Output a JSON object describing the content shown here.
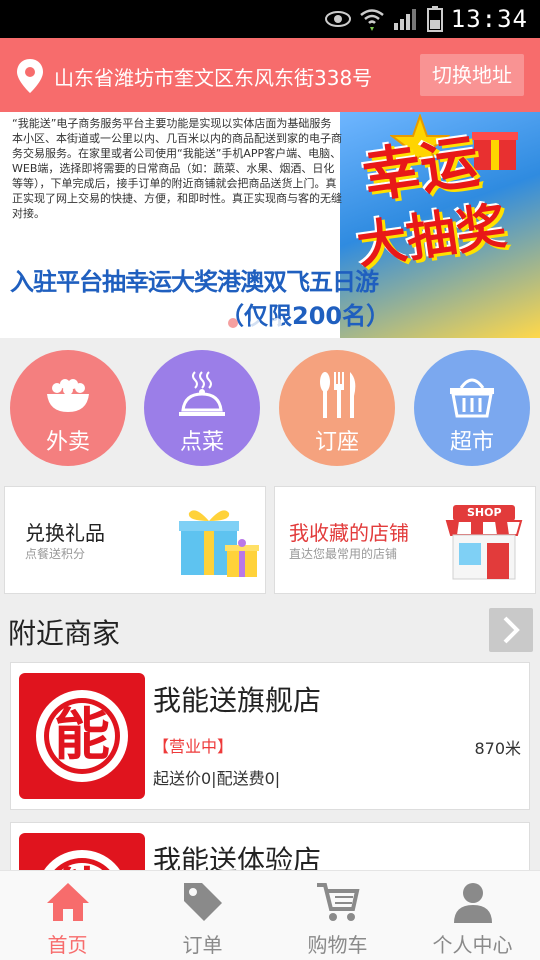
{
  "status_bar": {
    "time": "13:34"
  },
  "header": {
    "address": "山东省潍坊市奎文区东风东街338号",
    "switch_label": "切换地址",
    "accent": "#f76c6c"
  },
  "banner": {
    "intro_text": "“我能送”电子商务服务平台主要功能是实现以实体店面为基础服务本小区、本街道或一公里以内、几百米以内的商品配送到家的电子商务交易服务。在家里或者公司使用“我能送”手机APP客户端、电脑、WEB端，选择即将需要的日常商品（如：蔬菜、水果、烟酒、日化等等），下单完成后，接手订单的附近商铺就会把商品送货上门。真正实现了网上交易的快捷、方便，和即时性。真正实现商与客的无缝对接。",
    "promo_line1": "入驻平台抽幸运大奖港澳双飞五日游",
    "promo_line2": "（仅限200名）",
    "lucky_line1": "幸运",
    "lucky_line2": "大抽奖",
    "slide_count": 3,
    "active_slide": 1
  },
  "categories": [
    {
      "label": "外卖",
      "icon": "food-bowl-icon",
      "color": "#f47f7f"
    },
    {
      "label": "点菜",
      "icon": "dish-cover-icon",
      "color": "#9b7ee8"
    },
    {
      "label": "订座",
      "icon": "cutlery-icon",
      "color": "#f5a27e"
    },
    {
      "label": "超市",
      "icon": "basket-icon",
      "color": "#7ba8ef"
    }
  ],
  "cards": {
    "gift": {
      "title": "兑换礼品",
      "subtitle": "点餐送积分",
      "icon": "gift-box-icon"
    },
    "favorites": {
      "title": "我收藏的店铺",
      "subtitle": "直达您最常用的店铺",
      "icon": "shop-icon",
      "shop_sign": "SHOP"
    }
  },
  "nearby": {
    "title": "附近商家",
    "shops": [
      {
        "name": "我能送旗舰店",
        "status": "【营业中】",
        "distance": "870米",
        "fees": "起送价0|配送费0|",
        "logo_char": "能"
      },
      {
        "name": "我能送体验店",
        "logo_char": "能"
      }
    ]
  },
  "bottom_nav": [
    {
      "label": "首页",
      "icon": "home-icon",
      "active": true
    },
    {
      "label": "订单",
      "icon": "tag-icon",
      "active": false
    },
    {
      "label": "购物车",
      "icon": "cart-icon",
      "active": false
    },
    {
      "label": "个人中心",
      "icon": "person-icon",
      "active": false
    }
  ]
}
